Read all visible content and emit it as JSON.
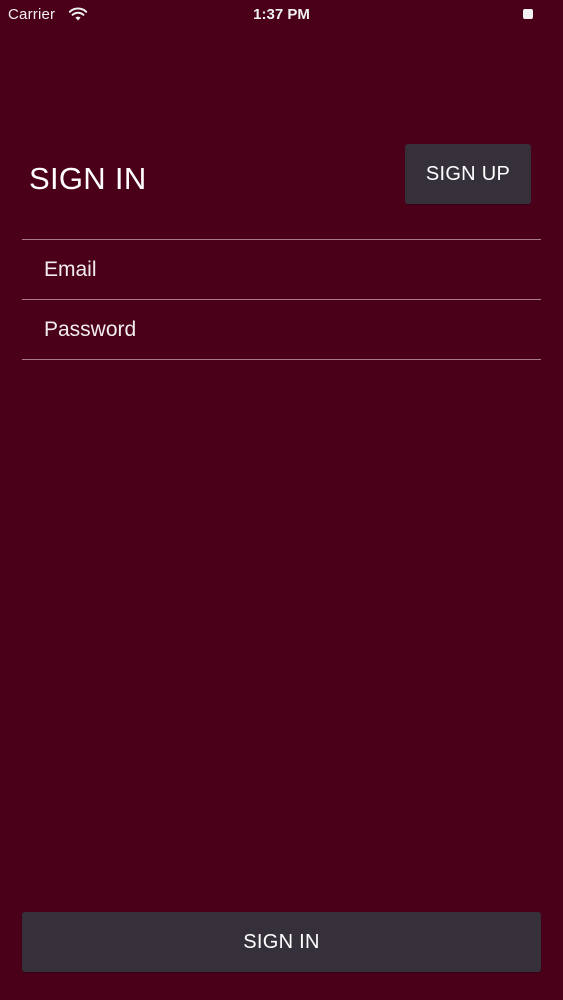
{
  "status_bar": {
    "carrier": "Carrier",
    "time": "1:37 PM",
    "wifi_icon": "wifi-icon",
    "battery_icon": "battery-icon"
  },
  "header": {
    "title": "SIGN IN",
    "signup_label": "SIGN UP"
  },
  "form": {
    "email_placeholder": "Email",
    "email_value": "",
    "password_placeholder": "Password",
    "password_value": ""
  },
  "footer": {
    "signin_label": "SIGN IN"
  },
  "colors": {
    "background": "#4b0019",
    "button": "#35303a",
    "divider": "#a87b8c",
    "text": "#ffffff"
  }
}
